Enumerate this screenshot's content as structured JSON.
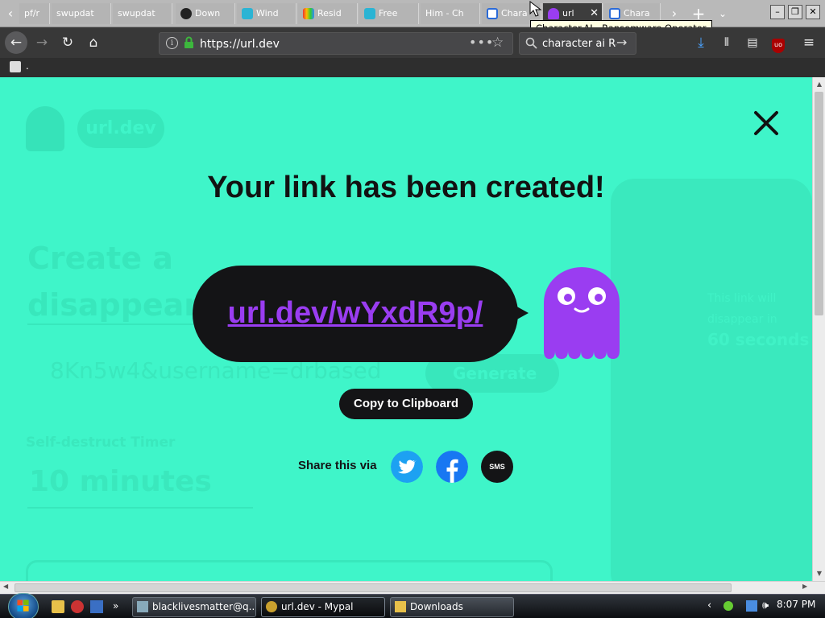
{
  "browser": {
    "tabs": [
      {
        "label": "pf/r",
        "favicon": "none"
      },
      {
        "label": "swupdat",
        "favicon": "none"
      },
      {
        "label": "swupdat",
        "favicon": "none"
      },
      {
        "label": "Down",
        "favicon": "w-icon"
      },
      {
        "label": "Wind",
        "favicon": "puzzle-icon"
      },
      {
        "label": "Resid",
        "favicon": "rainbow-icon"
      },
      {
        "label": "Free",
        "favicon": "puzzle-icon"
      },
      {
        "label": "Him - Ch",
        "favicon": "none"
      },
      {
        "label": "Chara",
        "favicon": "character-ai-icon"
      },
      {
        "label": "url",
        "favicon": "ghost-icon",
        "active": true
      },
      {
        "label": "Chara",
        "favicon": "character-ai-icon"
      }
    ],
    "tooltip": "Character.AI - Ransomware Operator",
    "url": "https://url.dev",
    "search_query": "character ai Ra",
    "bookmark_item": "."
  },
  "page": {
    "background_heading": "Create a disappearing link",
    "background_brand": "url.dev",
    "background_input": "8Kn5w4&username=drbased",
    "background_button": "Generate",
    "background_timer_label": "Self-destruct Timer",
    "background_timer_value": "10 minutes",
    "background_phone_text": "This link will disappear in",
    "background_phone_seconds": "60 seconds",
    "modal": {
      "title": "Your link has been created!",
      "short_link": "url.dev/wYxdR9p/",
      "copy_button": "Copy to Clipboard",
      "share_label": "Share this via",
      "share_options": [
        "twitter",
        "facebook",
        "SMS"
      ]
    }
  },
  "colors": {
    "backdrop": "#3ff5c9",
    "link": "#9a3df1",
    "ghost": "#9a3df1",
    "twitter": "#1da1f2",
    "facebook": "#1877f2"
  },
  "taskbar": {
    "tasks": [
      {
        "label": "blacklivesmatter@q..."
      },
      {
        "label": "url.dev - Mypal",
        "active": true
      },
      {
        "label": "Downloads"
      }
    ],
    "clock": "8:07 PM"
  }
}
